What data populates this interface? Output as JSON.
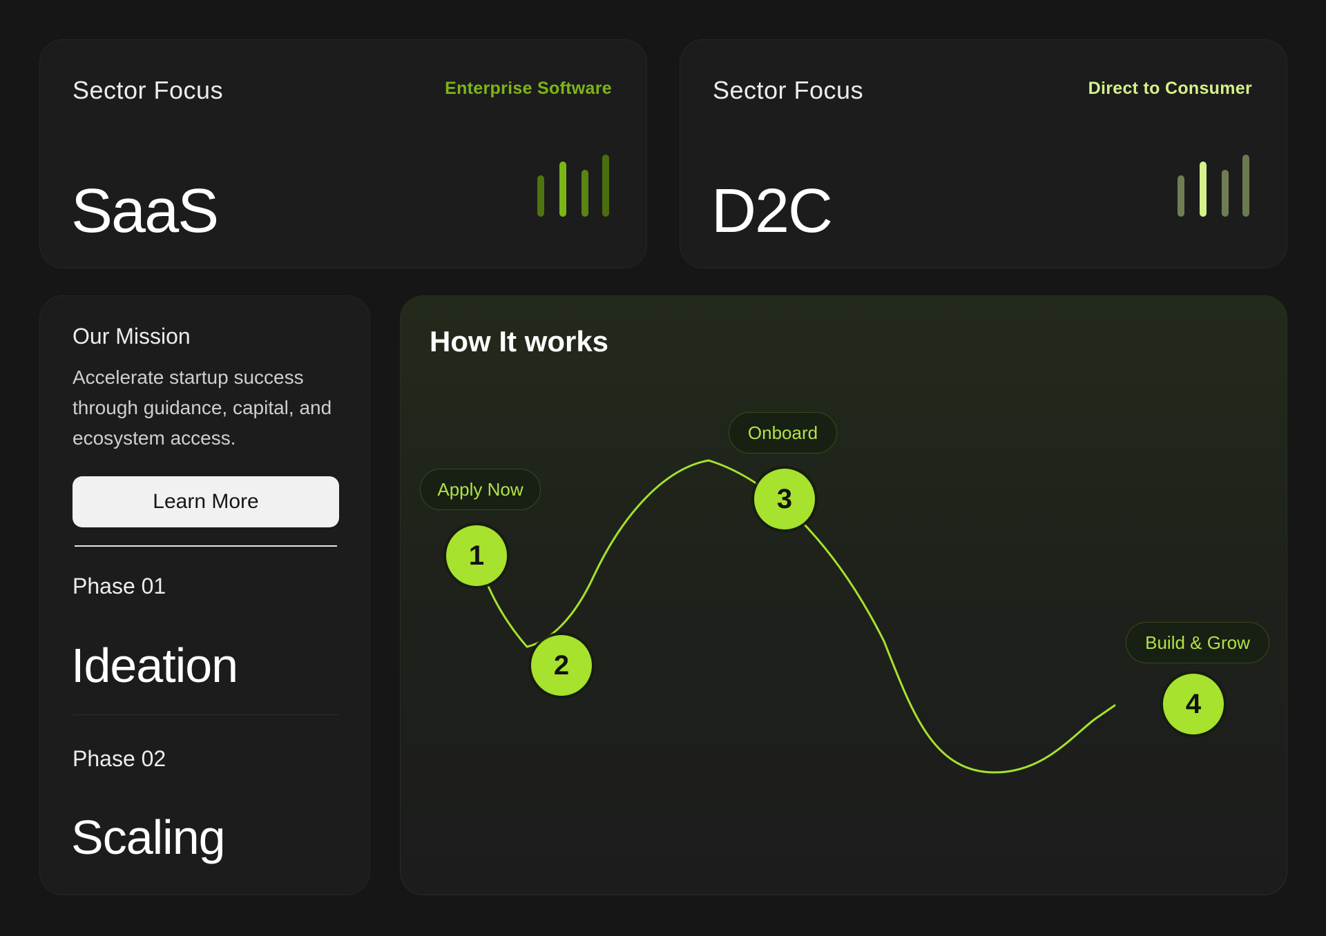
{
  "colors": {
    "accent": "#a6e22e",
    "tag_saas": "#7cb518",
    "tag_d2c": "#d4f18a",
    "background": "#161616",
    "card": "#1c1c1c"
  },
  "sectors": [
    {
      "label": "Sector Focus",
      "tag": "Enterprise Software",
      "name": "SaaS",
      "bar_colors": [
        "#4f7310",
        "#7cb518",
        "#5a8414",
        "#4a6d0f"
      ]
    },
    {
      "label": "Sector Focus",
      "tag": "Direct to Consumer",
      "name": "D2C",
      "bar_colors": [
        "#6f7d55",
        "#d4f18a",
        "#6f7d55",
        "#6a7a50"
      ]
    }
  ],
  "mission": {
    "title": "Our Mission",
    "text": "Accelerate startup success through guidance, capital, and ecosystem access.",
    "button_label": "Learn More",
    "phases": [
      {
        "label": "Phase 01",
        "name": "Ideation"
      },
      {
        "label": "Phase 02",
        "name": "Scaling"
      }
    ]
  },
  "how_it_works": {
    "title": "How It works",
    "steps": [
      {
        "number": "1",
        "label": "Apply Now"
      },
      {
        "number": "2",
        "label": ""
      },
      {
        "number": "3",
        "label": "Onboard"
      },
      {
        "number": "4",
        "label": "Build & Grow"
      }
    ]
  }
}
